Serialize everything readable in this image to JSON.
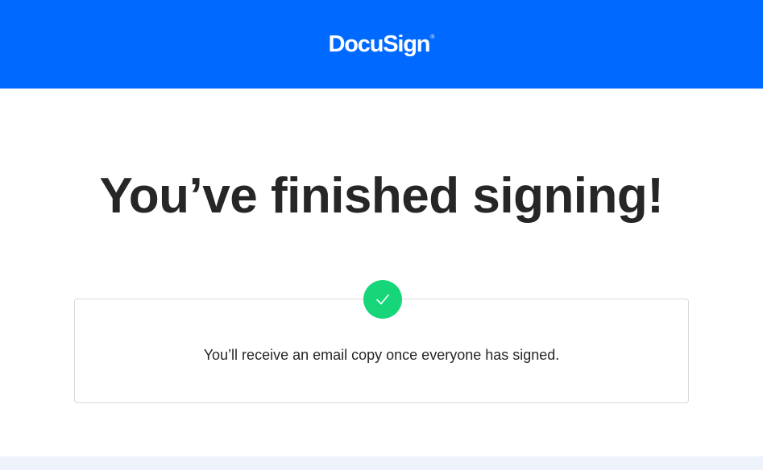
{
  "header": {
    "logo_text": "DocuSign",
    "logo_mark": "®",
    "background_color": "#0069ff"
  },
  "main": {
    "title": "You’ve finished signing!",
    "status_icon": "checkmark-icon",
    "status_color": "#17d67a",
    "message": "You’ll receive an email copy once everyone has signed."
  }
}
